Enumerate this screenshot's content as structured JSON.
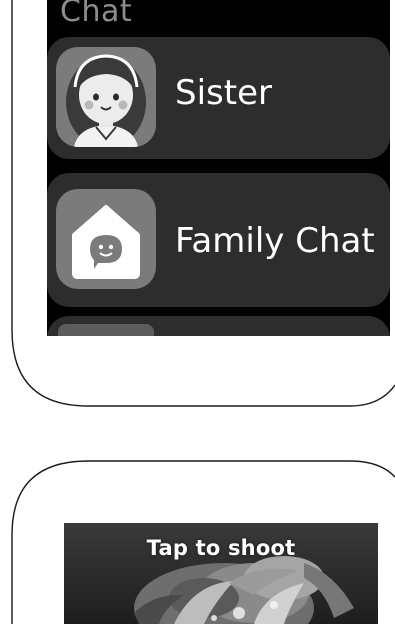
{
  "chat_screen": {
    "title": "Chat",
    "items": [
      {
        "name": "Sister",
        "icon": "girl-avatar-icon"
      },
      {
        "name": "Family Chat",
        "icon": "house-chat-icon"
      },
      {
        "name": "",
        "icon": "partial-avatar-icon"
      }
    ]
  },
  "camera_screen": {
    "tap_label": "Tap to shoot"
  },
  "colors": {
    "screen_bg": "#000000",
    "item_bg": "#2d2d2d",
    "title_text": "#8e8e8e",
    "item_text": "#ffffff",
    "avatar_bg": "#7b7b7b"
  }
}
